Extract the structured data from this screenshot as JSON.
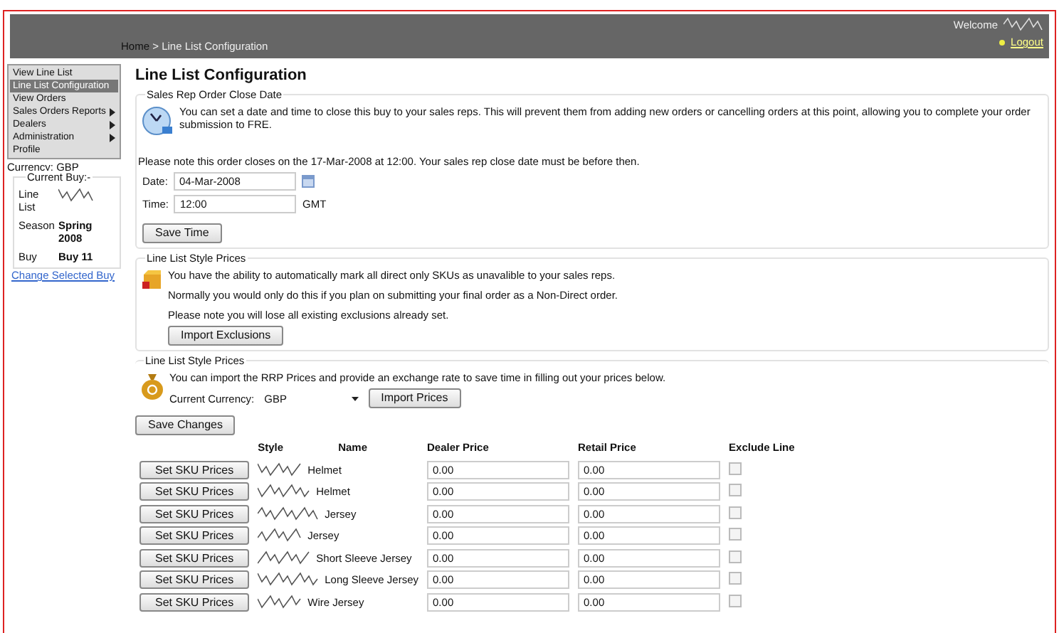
{
  "header": {
    "welcome": "Welcome",
    "logout": "Logout",
    "breadcrumb": {
      "home": "Home",
      "separator": ">",
      "current": "Line List Configuration"
    }
  },
  "sidebar": {
    "menu": [
      {
        "label": "View Line List",
        "selected": false,
        "submenu": false
      },
      {
        "label": "Line List Configuration",
        "selected": true,
        "submenu": false
      },
      {
        "label": "View Orders",
        "selected": false,
        "submenu": false
      },
      {
        "label": "Sales Orders Reports",
        "selected": false,
        "submenu": true
      },
      {
        "label": "Dealers",
        "selected": false,
        "submenu": true
      },
      {
        "label": "Administration",
        "selected": false,
        "submenu": true
      },
      {
        "label": "Profile",
        "selected": false,
        "submenu": false
      }
    ],
    "currency": "Currency: GBP",
    "current_buy": {
      "legend": "Current Buy:-",
      "rows": [
        {
          "label": "Line List",
          "kind": "redacted"
        },
        {
          "label": "Season",
          "kind": "text",
          "value": "Spring 2008"
        },
        {
          "label": "Buy",
          "kind": "text",
          "value": "Buy 11"
        }
      ],
      "link": "Change Selected Buy"
    }
  },
  "title": "Line List Configuration",
  "close_date": {
    "legend": "Sales Rep Order Close Date",
    "text": "You can set a date and time to close this buy to your sales reps. This will prevent them from adding new orders or cancelling orders at this point, allowing you to complete your order submission to FRE.",
    "note": "Please note this order closes on the 17-Mar-2008 at 12:00. Your sales rep close date must be before then.",
    "date_label": "Date:",
    "date": "04-Mar-2008",
    "time_label": "Time:",
    "time": "12:00",
    "timezone": "GMT",
    "button": "Save Time"
  },
  "exclusions": {
    "legend": "Line List Style Prices",
    "paragraphs": [
      "You have the ability to automatically mark all direct only SKUs as unavalible to your sales reps.",
      "Normally you would only do this if you plan on submitting your final order as a Non-Direct order.",
      "Please note you will lose all existing exclusions already set."
    ],
    "button": "Import Exclusions"
  },
  "import_prices": {
    "legend": "Line List Style Prices",
    "text": "You can import the RRP Prices and provide an exchange rate to save time in filling out your prices below.",
    "currency_label": "Current Currency:",
    "currency": "GBP",
    "button": "Import Prices"
  },
  "save_button": "Save Changes",
  "table": {
    "columns": [
      "Style",
      "Name",
      "Dealer Price",
      "Retail Price",
      "Exclude Line"
    ],
    "rows": [
      {
        "button": "Set SKU Prices",
        "name": "Helmet",
        "dealer_price": "0.00",
        "retail_price": "0.00",
        "exclude": false
      },
      {
        "button": "Set SKU Prices",
        "name": "Helmet",
        "dealer_price": "0.00",
        "retail_price": "0.00",
        "exclude": false
      },
      {
        "button": "Set SKU Prices",
        "name": "Jersey",
        "dealer_price": "0.00",
        "retail_price": "0.00",
        "exclude": false
      },
      {
        "button": "Set SKU Prices",
        "name": "Jersey",
        "dealer_price": "0.00",
        "retail_price": "0.00",
        "exclude": false
      },
      {
        "button": "Set SKU Prices",
        "name": "Short Sleeve Jersey",
        "dealer_price": "0.00",
        "retail_price": "0.00",
        "exclude": false
      },
      {
        "button": "Set SKU Prices",
        "name": "Long Sleeve Jersey",
        "dealer_price": "0.00",
        "retail_price": "0.00",
        "exclude": false
      },
      {
        "button": "Set SKU Prices",
        "name": "Wire Jersey",
        "dealer_price": "0.00",
        "retail_price": "0.00",
        "exclude": false
      }
    ]
  }
}
